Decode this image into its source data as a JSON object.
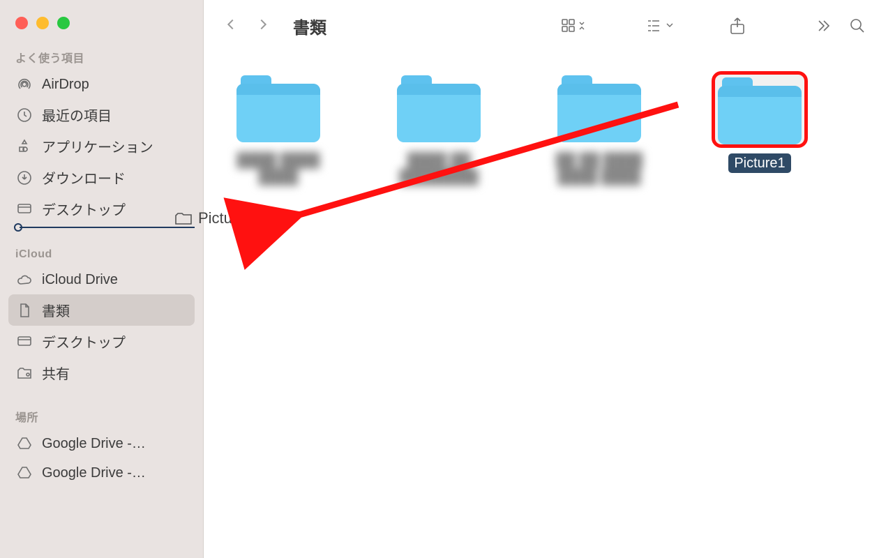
{
  "window": {
    "title": "書類"
  },
  "sidebar": {
    "sections": {
      "favorites": {
        "label": "よく使う項目",
        "items": [
          {
            "label": "AirDrop",
            "icon": "airdrop"
          },
          {
            "label": "最近の項目",
            "icon": "clock"
          },
          {
            "label": "アプリケーション",
            "icon": "apps"
          },
          {
            "label": "ダウンロード",
            "icon": "download"
          },
          {
            "label": "デスクトップ",
            "icon": "desktop"
          }
        ]
      },
      "icloud": {
        "label": "iCloud",
        "items": [
          {
            "label": "iCloud Drive",
            "icon": "cloud"
          },
          {
            "label": "書類",
            "icon": "doc",
            "selected": true
          },
          {
            "label": "デスクトップ",
            "icon": "desktop"
          },
          {
            "label": "共有",
            "icon": "shared"
          }
        ]
      },
      "locations": {
        "label": "場所",
        "items": [
          {
            "label": "Google Drive -…",
            "icon": "gdrive"
          },
          {
            "label": "Google Drive -…",
            "icon": "gdrive"
          }
        ]
      }
    }
  },
  "drag": {
    "label": "Picture1"
  },
  "files": [
    {
      "name": "████ ████ ████",
      "redacted": true
    },
    {
      "name": "████ ██ ████████",
      "redacted": true
    },
    {
      "name": "██ ██ ████ ████ ████",
      "redacted": true
    },
    {
      "name": "Picture1",
      "selected": true,
      "highlight": true
    }
  ],
  "annotation": {
    "type": "arrow",
    "color": "#ff1110"
  }
}
